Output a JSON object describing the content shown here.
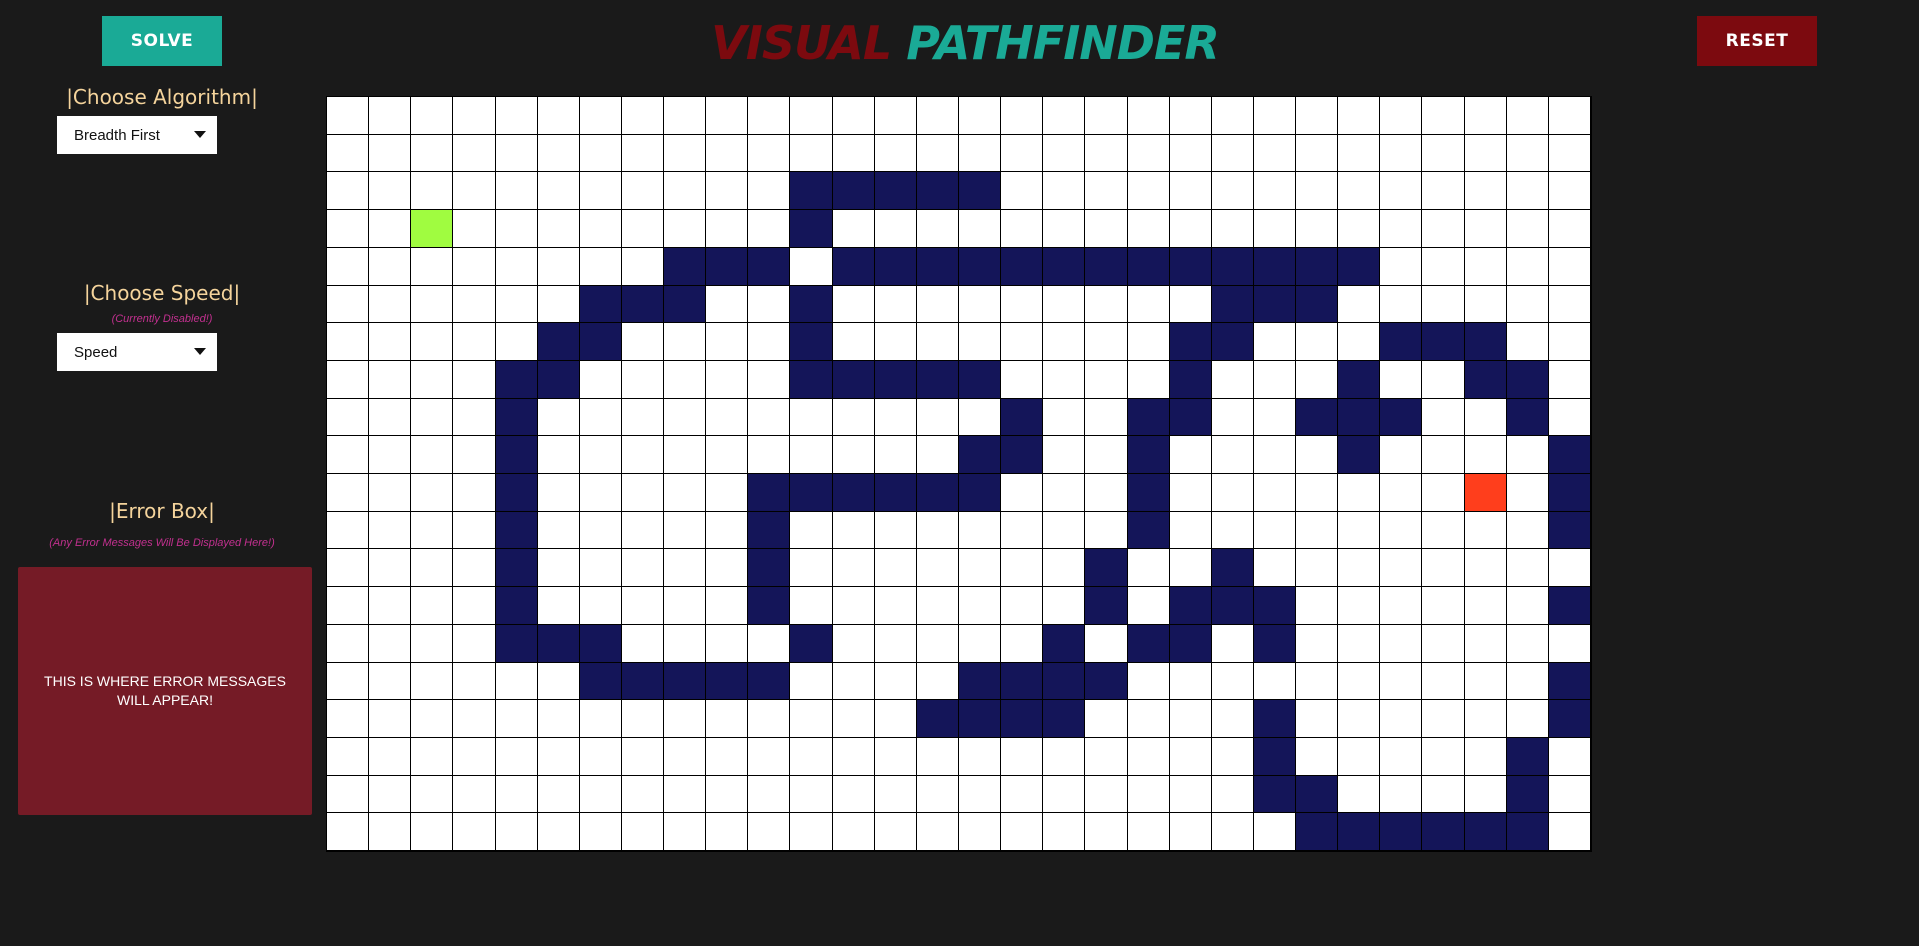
{
  "header": {
    "title_part1": "VISUAL",
    "title_part2": "PATHFINDER",
    "solve_label": "SOLVE",
    "reset_label": "RESET"
  },
  "sidebar": {
    "algorithm_heading": "|Choose Algorithm|",
    "algorithm_selected": "Breadth First",
    "speed_heading": "|Choose Speed|",
    "speed_note": "(Currently Disabled!)",
    "speed_selected": "Speed",
    "error_heading": "|Error Box|",
    "error_note": "(Any Error Messages Will Be Displayed Here!)",
    "error_message": "THIS IS WHERE ERROR MESSAGES WILL APPEAR!"
  },
  "colors": {
    "accent_teal": "#1aaa96",
    "accent_red": "#7c0a0f",
    "wall": "#141559",
    "start": "#a0fc40",
    "end": "#ff3e1c",
    "empty": "#ffffff",
    "background": "#1a1a1a"
  },
  "grid": {
    "rows": 20,
    "cols": 30,
    "start": [
      3,
      2
    ],
    "end": [
      10,
      27
    ],
    "walls": [
      [
        2,
        11
      ],
      [
        2,
        12
      ],
      [
        2,
        13
      ],
      [
        2,
        14
      ],
      [
        2,
        15
      ],
      [
        3,
        11
      ],
      [
        4,
        8
      ],
      [
        4,
        9
      ],
      [
        4,
        10
      ],
      [
        4,
        12
      ],
      [
        4,
        13
      ],
      [
        4,
        14
      ],
      [
        4,
        15
      ],
      [
        4,
        16
      ],
      [
        4,
        17
      ],
      [
        4,
        18
      ],
      [
        4,
        19
      ],
      [
        4,
        20
      ],
      [
        4,
        21
      ],
      [
        4,
        22
      ],
      [
        4,
        23
      ],
      [
        4,
        24
      ],
      [
        5,
        6
      ],
      [
        5,
        7
      ],
      [
        5,
        8
      ],
      [
        5,
        11
      ],
      [
        5,
        21
      ],
      [
        5,
        22
      ],
      [
        5,
        23
      ],
      [
        6,
        5
      ],
      [
        6,
        6
      ],
      [
        6,
        11
      ],
      [
        6,
        20
      ],
      [
        6,
        21
      ],
      [
        6,
        25
      ],
      [
        6,
        26
      ],
      [
        6,
        27
      ],
      [
        7,
        4
      ],
      [
        7,
        5
      ],
      [
        7,
        11
      ],
      [
        7,
        12
      ],
      [
        7,
        13
      ],
      [
        7,
        14
      ],
      [
        7,
        15
      ],
      [
        7,
        20
      ],
      [
        7,
        24
      ],
      [
        7,
        27
      ],
      [
        7,
        28
      ],
      [
        8,
        4
      ],
      [
        8,
        16
      ],
      [
        8,
        19
      ],
      [
        8,
        20
      ],
      [
        8,
        23
      ],
      [
        8,
        24
      ],
      [
        8,
        25
      ],
      [
        8,
        28
      ],
      [
        9,
        4
      ],
      [
        9,
        15
      ],
      [
        9,
        16
      ],
      [
        9,
        19
      ],
      [
        9,
        24
      ],
      [
        9,
        29
      ],
      [
        10,
        4
      ],
      [
        10,
        10
      ],
      [
        10,
        11
      ],
      [
        10,
        12
      ],
      [
        10,
        13
      ],
      [
        10,
        14
      ],
      [
        10,
        15
      ],
      [
        10,
        19
      ],
      [
        10,
        29
      ],
      [
        11,
        4
      ],
      [
        11,
        10
      ],
      [
        11,
        19
      ],
      [
        11,
        29
      ],
      [
        12,
        4
      ],
      [
        12,
        10
      ],
      [
        12,
        18
      ],
      [
        12,
        21
      ],
      [
        13,
        4
      ],
      [
        13,
        10
      ],
      [
        13,
        18
      ],
      [
        13,
        20
      ],
      [
        13,
        21
      ],
      [
        13,
        22
      ],
      [
        13,
        29
      ],
      [
        14,
        4
      ],
      [
        14,
        5
      ],
      [
        14,
        6
      ],
      [
        14,
        11
      ],
      [
        14,
        17
      ],
      [
        14,
        19
      ],
      [
        14,
        20
      ],
      [
        14,
        22
      ],
      [
        15,
        6
      ],
      [
        15,
        7
      ],
      [
        15,
        8
      ],
      [
        15,
        9
      ],
      [
        15,
        10
      ],
      [
        15,
        15
      ],
      [
        15,
        16
      ],
      [
        15,
        17
      ],
      [
        15,
        18
      ],
      [
        15,
        29
      ],
      [
        16,
        14
      ],
      [
        16,
        15
      ],
      [
        16,
        16
      ],
      [
        16,
        17
      ],
      [
        16,
        22
      ],
      [
        16,
        29
      ],
      [
        17,
        22
      ],
      [
        17,
        28
      ],
      [
        18,
        22
      ],
      [
        18,
        23
      ],
      [
        18,
        28
      ],
      [
        19,
        23
      ],
      [
        19,
        24
      ],
      [
        19,
        25
      ],
      [
        19,
        26
      ],
      [
        19,
        27
      ],
      [
        19,
        28
      ]
    ]
  }
}
